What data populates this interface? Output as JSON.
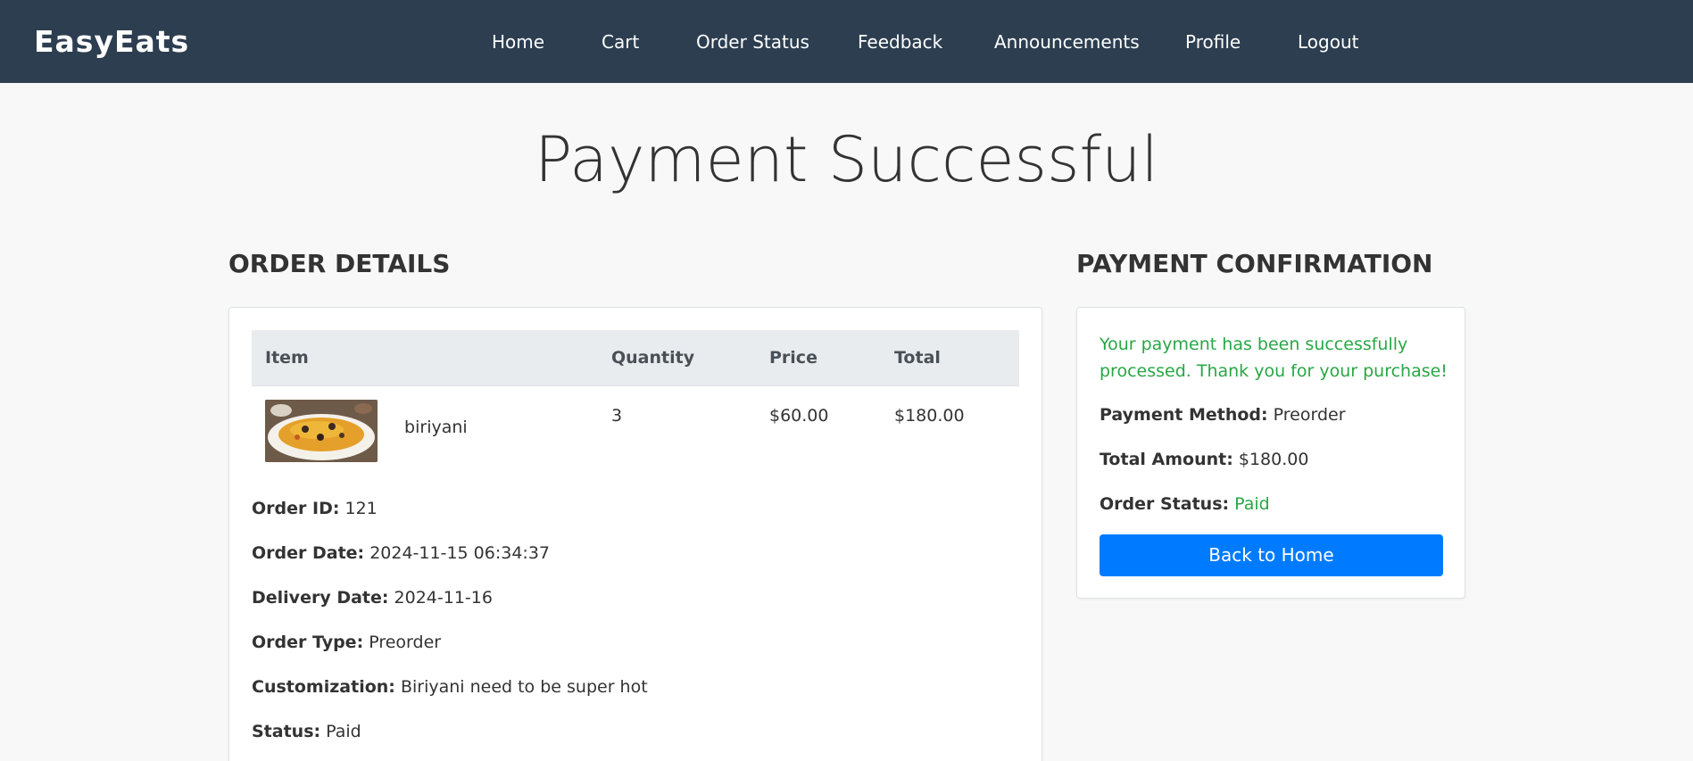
{
  "nav": {
    "brand": "EasyEats",
    "links": [
      "Home",
      "Cart",
      "Order Status",
      "Feedback",
      "Announcements",
      "Profile",
      "Logout"
    ]
  },
  "page_title": "Payment Successful",
  "order_details": {
    "heading": "ORDER DETAILS",
    "columns": [
      "Item",
      "Quantity",
      "Price",
      "Total"
    ],
    "rows": [
      {
        "item": "biriyani",
        "image": "biriyani-food-image",
        "quantity": "3",
        "price": "$60.00",
        "total": "$180.00"
      }
    ],
    "fields": [
      {
        "label": "Order ID:",
        "value": "121"
      },
      {
        "label": "Order Date:",
        "value": "2024-11-15 06:34:37"
      },
      {
        "label": "Delivery Date:",
        "value": "2024-11-16"
      },
      {
        "label": "Order Type:",
        "value": "Preorder"
      },
      {
        "label": "Customization:",
        "value": "Biriyani need to be super hot"
      },
      {
        "label": "Status:",
        "value": "Paid"
      }
    ]
  },
  "payment_confirmation": {
    "heading": "PAYMENT CONFIRMATION",
    "message": "Your payment has been successfully processed. Thank you for your purchase!",
    "method_label": "Payment Method:",
    "method_value": "Preorder",
    "amount_label": "Total Amount:",
    "amount_value": "$180.00",
    "status_label": "Order Status:",
    "status_value": "Paid",
    "button_label": "Back to Home"
  },
  "colors": {
    "navbar": "#2c3e50",
    "success": "#28a745",
    "primary_button": "#007bff",
    "page_background": "#f8f8f8"
  }
}
